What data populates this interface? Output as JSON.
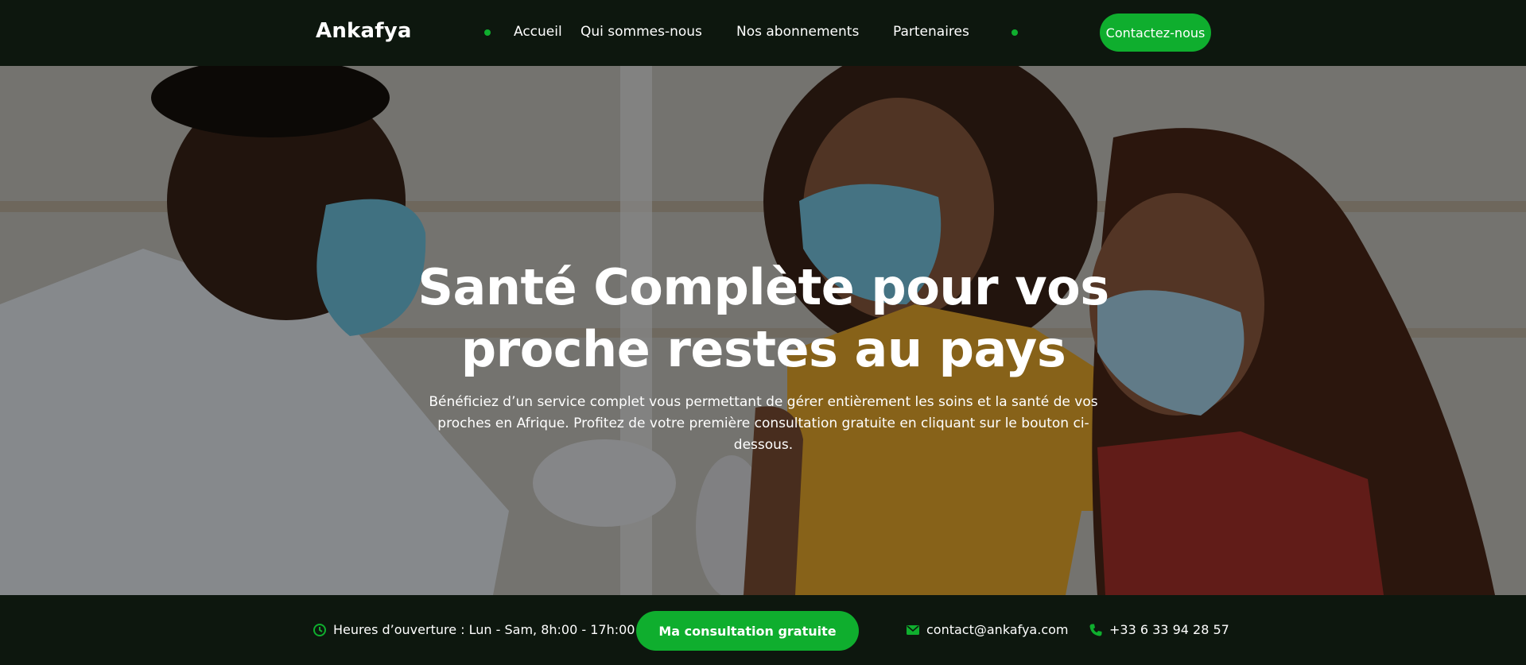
{
  "brand": {
    "name": "Ankafya"
  },
  "nav": {
    "items": [
      {
        "label": "Accueil"
      },
      {
        "label": "Qui sommes-nous"
      },
      {
        "label": "Nos abonnements"
      },
      {
        "label": "Partenaires"
      }
    ],
    "cta_label": "Contactez-nous"
  },
  "hero": {
    "title_line1": "Santé Complète pour vos",
    "title_line2": "proche restes au pays",
    "description": "Bénéficiez d’un service complet vous permettant de gérer entièrement les soins et la santé de vos proches en Afrique. Profitez de votre première consultation gratuite en cliquant sur le bouton ci-dessous.",
    "image_alt_icon": "hero-photo-doctor-vaccinating-child"
  },
  "infobar": {
    "hours": "Heures d’ouverture : Lun - Sam, 8h:00 - 17h:00",
    "cta_label": "Ma consultation gratuite",
    "email": "contact@ankafya.com",
    "phone": "+33 6 33 94 28 57",
    "icons": {
      "hours": "clock-icon",
      "email": "mail-icon",
      "phone": "phone-icon"
    }
  },
  "colors": {
    "accent": "#0fae2e",
    "background": "#0d170e",
    "text": "#ffffff"
  }
}
